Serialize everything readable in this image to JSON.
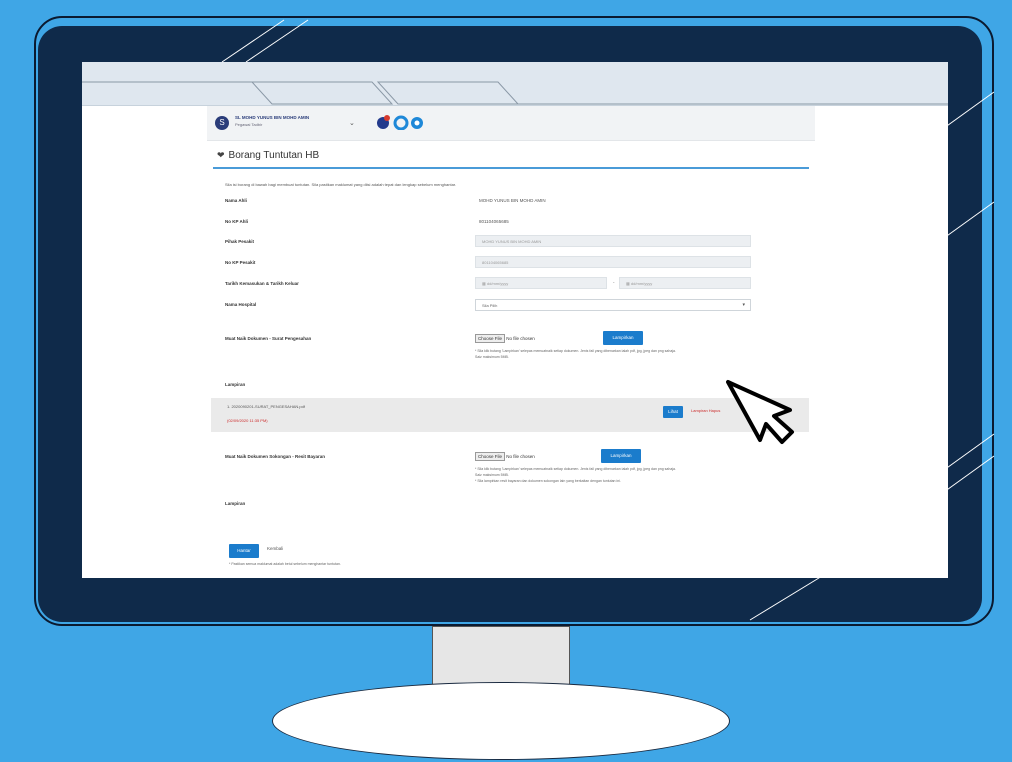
{
  "app": {
    "user": {
      "avatar_initial": "S",
      "name": "SL MOHD YUNUS BIN MOHD AMIN",
      "role": "Pegawai Tadbir"
    },
    "page_title": "Borang Tuntutan HB",
    "intro_text": "Sila isi borang di bawah bagi membuat tuntutan. Sila pastikan maklumat yang diisi adalah tepat dan lengkap sebelum menghantar.",
    "fields": [
      {
        "label": "Nama Ahli",
        "value": "MOHD YUNUS BIN MOHD AMIN"
      },
      {
        "label": "No KP Ahli",
        "value": "801104065685"
      },
      {
        "label": "Pihak Pesakit",
        "value": "MOHD YUNUS BIN MOHD AMIN"
      },
      {
        "label": "No KP Pesakit",
        "value": "801104065685"
      },
      {
        "label": "Tarikh Kemasukan & Tarikh Keluar",
        "date_from": "dd/mm/yyyy",
        "date_to": "dd/mm/yyyy"
      },
      {
        "label": "Nama Hospital",
        "value": "Sila Pilih"
      }
    ],
    "upload1": {
      "label": "Muat Naik Dokumen - Surat Pengesahan",
      "choose_file": "Choose File",
      "no_file": "No file chosen",
      "button": "Lampirkan",
      "hint_line1": "* Sila klik butang 'Lampirkan' selepas memuatnaik setiap dokumen. Jenis fail yang dibenarkan ialah pdf, jpg, jpeg dan png sahaja.",
      "hint_line2": "Saiz maksimum 5MB."
    },
    "lampiran1": {
      "label": "Lampiran",
      "file_name": "1. 2020090201-SURAT_PENGESAHAN.pdf",
      "file_meta": "(02/09/2020 11:35 PM)",
      "view_button": "Lihat",
      "delete_link": "Lampiran Hapus"
    },
    "upload2": {
      "label": "Muat Naik Dokumen Sokongan - Resit Bayaran",
      "choose_file": "Choose File",
      "no_file": "No file chosen",
      "button": "Lampirkan",
      "hint_line1": "* Sila klik butang 'Lampirkan' selepas memuatnaik setiap dokumen. Jenis fail yang dibenarkan ialah pdf, jpg, jpeg dan png sahaja.",
      "hint_line2": "Saiz maksimum 5MB.",
      "hint_line3": "* Sila lampirkan resit bayaran dan dokumen sokongan lain yang berkaitan dengan tuntutan ini."
    },
    "lampiran2": {
      "label": "Lampiran"
    },
    "actions": {
      "submit": "Hantar",
      "back": "Kembali"
    },
    "footer_note": "* Pastikan semua maklumat adalah betul sebelum menghantar tuntutan."
  },
  "colors": {
    "background": "#3fa6e6",
    "monitor": "#0f2a4a",
    "primary_button": "#1b7ccc",
    "accent_line": "#4a9bd8",
    "danger": "#cc2b2b"
  },
  "icons": {
    "title": "heart-icon",
    "cursor": "arrow-cursor-icon",
    "dropdown": "chevron-down-icon",
    "calendar": "calendar-icon"
  }
}
